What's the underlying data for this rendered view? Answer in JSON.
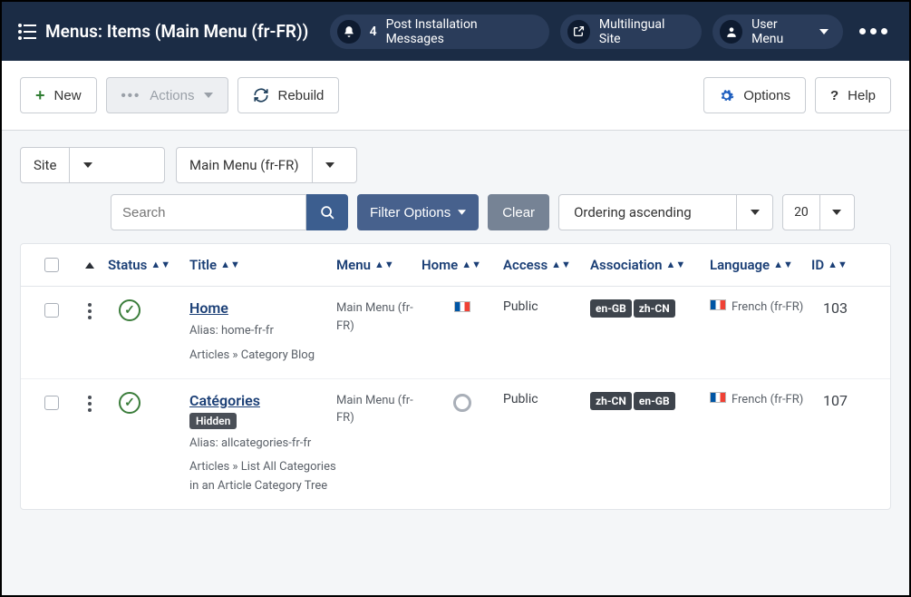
{
  "header": {
    "title": "Menus: Items (Main Menu (fr-FR))",
    "notifications": {
      "count": "4",
      "label": "Post Installation Messages"
    },
    "site_link": "Multilingual Site",
    "user_menu": "User Menu"
  },
  "toolbar": {
    "new": "New",
    "actions": "Actions",
    "rebuild": "Rebuild",
    "options": "Options",
    "help": "Help"
  },
  "filters": {
    "client": "Site",
    "menu": "Main Menu (fr-FR)",
    "search_placeholder": "Search",
    "filter_options": "Filter Options",
    "clear": "Clear",
    "ordering": "Ordering ascending",
    "page_size": "20"
  },
  "columns": {
    "status": "Status",
    "title": "Title",
    "menu": "Menu",
    "home": "Home",
    "access": "Access",
    "association": "Association",
    "language": "Language",
    "id": "ID"
  },
  "rows": [
    {
      "title": "Home",
      "hidden": false,
      "alias": "Alias: home-fr-fr",
      "path": "Articles » Category Blog",
      "menu": "Main Menu (fr-FR)",
      "home_default": true,
      "access": "Public",
      "associations": [
        "en-GB",
        "zh-CN"
      ],
      "language": "French (fr-FR)",
      "id": "103"
    },
    {
      "title": "Catégories",
      "hidden": true,
      "hidden_label": "Hidden",
      "alias": "Alias: allcategories-fr-fr",
      "path": "Articles » List All Categories in an Article Category Tree",
      "menu": "Main Menu (fr-FR)",
      "home_default": false,
      "access": "Public",
      "associations": [
        "zh-CN",
        "en-GB"
      ],
      "language": "French (fr-FR)",
      "id": "107"
    }
  ]
}
